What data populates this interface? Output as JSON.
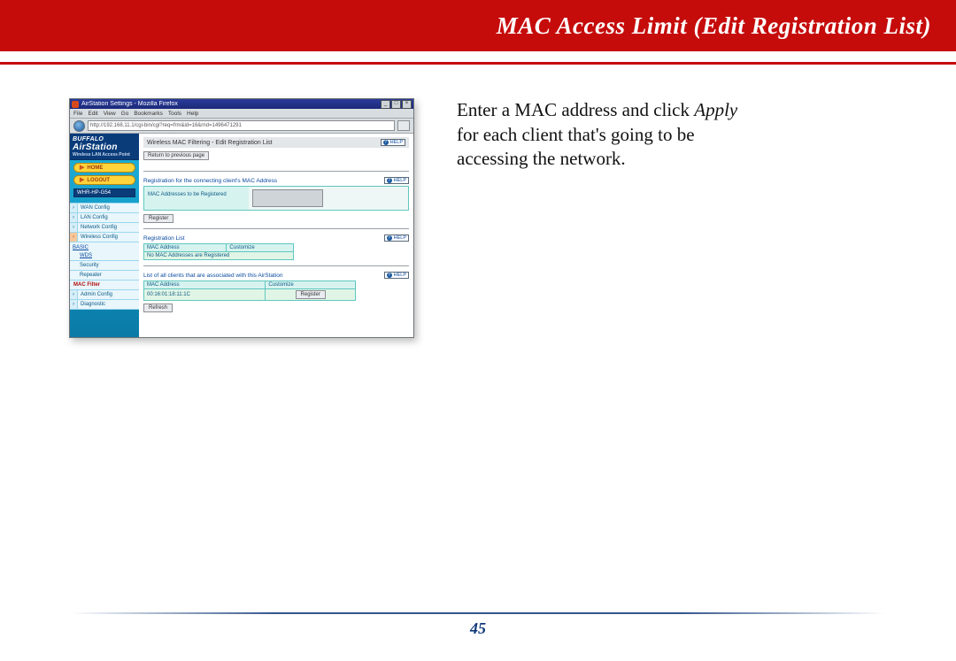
{
  "banner": {
    "title": "MAC Access Limit (Edit Registration List)"
  },
  "instruction": {
    "line1_a": "Enter a MAC address and click ",
    "line1_em": "Apply",
    "line2": "for each client that's going to be",
    "line3": "accessing the network."
  },
  "page_number": "45",
  "browser": {
    "window_title": "AirStation Settings - Mozilla Firefox",
    "btn_min": "_",
    "btn_max": "□",
    "btn_close": "×",
    "menus": [
      "File",
      "Edit",
      "View",
      "Go",
      "Bookmarks",
      "Tools",
      "Help"
    ],
    "url": "http://192.168.11.1/cgi-bin/cgi?req=frm&id=16&rnd=1496471291"
  },
  "sidebar": {
    "brand_top": "BUFFALO",
    "brand_main": "AirStation",
    "brand_sub": "Wireless LAN Access Point",
    "home": "HOME",
    "logout": "LOGOUT",
    "model": "WHR-HP-G54",
    "items": {
      "wan": "WAN Config",
      "lan": "LAN Config",
      "net": "Network Config",
      "wifi": "Wireless Config"
    },
    "group_basic": "BASIC",
    "basic_items": {
      "wds": "WDS",
      "sec": "Security",
      "repeat": "Repeater"
    },
    "mac_filter": "MAC Filter",
    "admin_items": {
      "admin": "Admin Config",
      "diag": "Diagnostic"
    }
  },
  "main": {
    "page_title": "Wireless MAC Filtering - Edit Registration List",
    "help": "HELP",
    "back": "Return to previous page",
    "section_register": "Registration for the connecting client's MAC Address",
    "reg_label": "MAC Addresses to be Registered",
    "register_btn": "Register",
    "section_list": "Registration List",
    "list_headers": {
      "mac": "MAC Address",
      "cust": "Customize"
    },
    "list_empty": "No MAC Addresses are Registered",
    "section_assoc": "List of all clients that are associated with this AirStation",
    "assoc_headers": {
      "mac": "MAC Address",
      "cust": "Customize"
    },
    "assoc_rows": [
      {
        "mac": "00:16:01:18:11:1C",
        "btn": "Register"
      }
    ],
    "refresh_btn": "Refresh"
  }
}
